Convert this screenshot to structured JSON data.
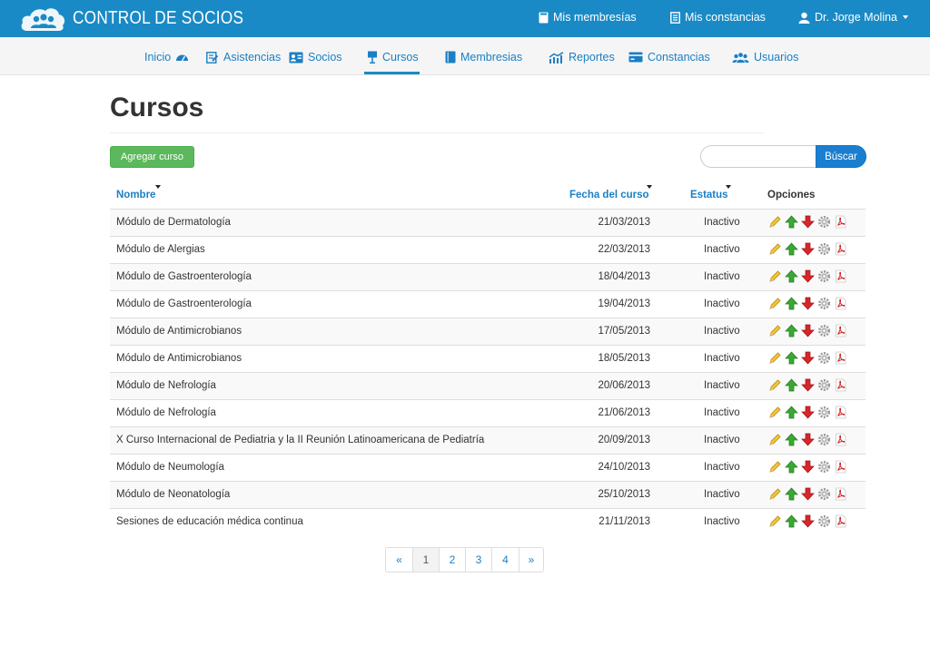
{
  "app": {
    "title": "CONTROL DE SOCIOS"
  },
  "topbar": {
    "mis_membresias": "Mis membresías",
    "mis_constancias": "Mis constancias",
    "user_name": "Dr. Jorge Molina"
  },
  "nav": {
    "inicio": "Inicio",
    "asistencias": "Asistencias",
    "socios": "Socios",
    "cursos": "Cursos",
    "membresias": "Membresias",
    "reportes": "Reportes",
    "constancias": "Constancias",
    "usuarios": "Usuarios",
    "active": "Cursos"
  },
  "page": {
    "title": "Cursos",
    "add_button": "Agregar curso",
    "search_placeholder": "",
    "search_button": "Búscar"
  },
  "table": {
    "headers": {
      "nombre": "Nombre",
      "fecha": "Fecha del curso",
      "estatus": "Estatus",
      "opciones": "Opciones"
    },
    "rows": [
      {
        "nombre": "Módulo de Dermatología",
        "fecha": "21/03/2013",
        "estatus": "Inactivo"
      },
      {
        "nombre": "Módulo de Alergias",
        "fecha": "22/03/2013",
        "estatus": "Inactivo"
      },
      {
        "nombre": "Módulo de Gastroenterología",
        "fecha": "18/04/2013",
        "estatus": "Inactivo"
      },
      {
        "nombre": "Módulo de Gastroenterología",
        "fecha": "19/04/2013",
        "estatus": "Inactivo"
      },
      {
        "nombre": "Módulo de Antimicrobianos",
        "fecha": "17/05/2013",
        "estatus": "Inactivo"
      },
      {
        "nombre": "Módulo de Antimicrobianos",
        "fecha": "18/05/2013",
        "estatus": "Inactivo"
      },
      {
        "nombre": "Módulo de Nefrología",
        "fecha": "20/06/2013",
        "estatus": "Inactivo"
      },
      {
        "nombre": "Módulo de Nefrología",
        "fecha": "21/06/2013",
        "estatus": "Inactivo"
      },
      {
        "nombre": "X Curso Internacional de Pediatria y la II Reunión Latinoamericana de Pediatría",
        "fecha": "20/09/2013",
        "estatus": "Inactivo"
      },
      {
        "nombre": "Módulo de Neumología",
        "fecha": "24/10/2013",
        "estatus": "Inactivo"
      },
      {
        "nombre": "Módulo de Neonatología",
        "fecha": "25/10/2013",
        "estatus": "Inactivo"
      },
      {
        "nombre": "Sesiones de educación médica continua",
        "fecha": "21/11/2013",
        "estatus": "Inactivo"
      }
    ],
    "row_actions": [
      "edit-icon",
      "move-up-icon",
      "move-down-icon",
      "settings-icon",
      "pdf-icon"
    ]
  },
  "pagination": {
    "prev": "«",
    "pages": [
      "1",
      "2",
      "3",
      "4"
    ],
    "next": "»",
    "current": "1"
  },
  "colors": {
    "header_bg": "#1a8ac6",
    "link": "#1a7fc4",
    "add_button": "#5cb85c",
    "search_button": "#1a7fd0"
  }
}
